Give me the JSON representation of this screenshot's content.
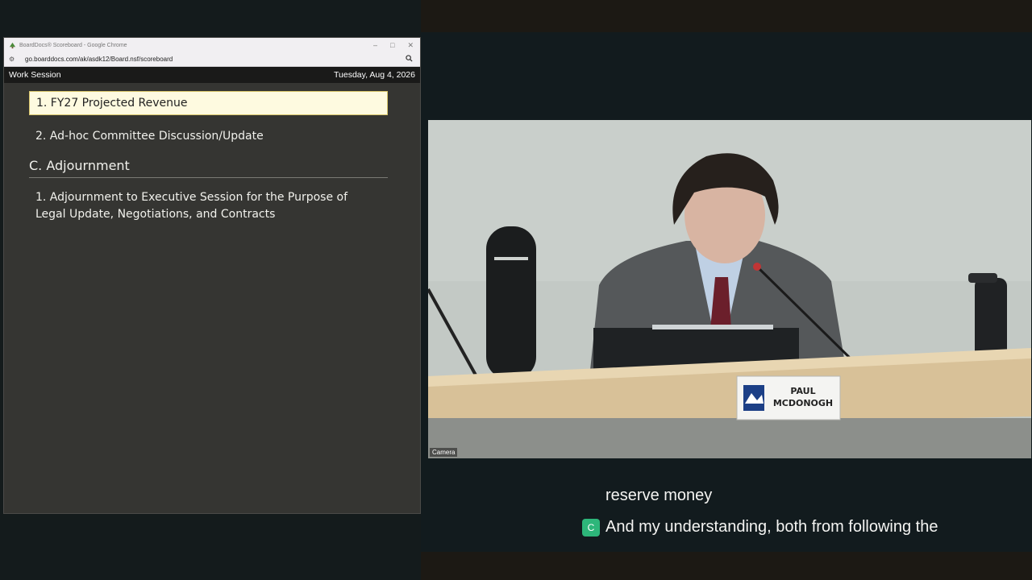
{
  "browser": {
    "window_title": "BoardDocs® Scoreboard - Google Chrome",
    "url": "go.boarddocs.com/ak/asdk12/Board.nsf/scoreboard"
  },
  "scoreboard": {
    "meeting_type": "Work Session",
    "date": "Tuesday, Aug 4, 2026"
  },
  "agenda": {
    "active_item": "1. FY27 Projected Revenue",
    "item2": "2. Ad-hoc Committee Discussion/Update",
    "section": "C. Adjournment",
    "section_item1": "1. Adjournment to Executive Session for the Purpose of Legal Update, Negotiations, and Contracts"
  },
  "video": {
    "camera_label": "Camera",
    "nameplate_line1": "PAUL",
    "nameplate_line2": "MCDONOGH"
  },
  "captions": {
    "line1": "reserve money",
    "line2": "And my understanding, both from following the",
    "speaker_badge": "C"
  },
  "colors": {
    "active_item_bg": "#fefae0",
    "caption_badge": "#2db67a"
  }
}
